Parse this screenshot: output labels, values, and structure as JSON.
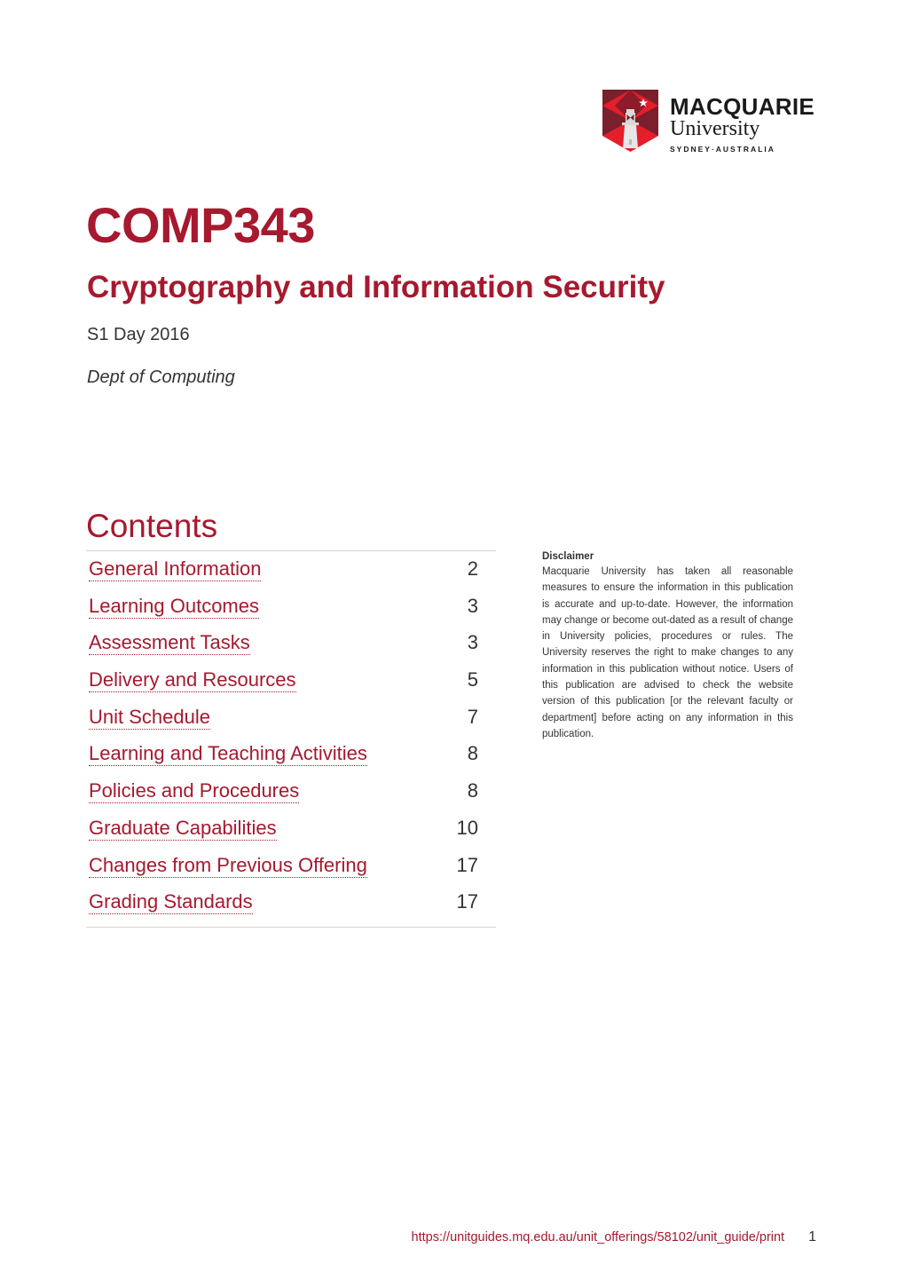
{
  "logo": {
    "name": "MACQUARIE",
    "sub": "University",
    "location": "SYDNEY·AUSTRALIA",
    "colors": {
      "red": "#e41e2b",
      "dark_red": "#7a1f2b",
      "tower": "#d9d9d9"
    }
  },
  "header": {
    "course_code": "COMP343",
    "course_title": "Cryptography and Information Security",
    "offering": "S1 Day 2016",
    "department": "Dept of Computing"
  },
  "contents": {
    "title": "Contents",
    "items": [
      {
        "label": "General Information",
        "page": "2"
      },
      {
        "label": "Learning Outcomes",
        "page": "3"
      },
      {
        "label": "Assessment Tasks",
        "page": "3"
      },
      {
        "label": "Delivery and Resources",
        "page": "5"
      },
      {
        "label": "Unit Schedule",
        "page": "7"
      },
      {
        "label": "Learning and Teaching Activities",
        "page": "8"
      },
      {
        "label": "Policies and Procedures",
        "page": "8"
      },
      {
        "label": "Graduate Capabilities",
        "page": "10"
      },
      {
        "label": "Changes from Previous Offering",
        "page": "17"
      },
      {
        "label": "Grading Standards",
        "page": "17"
      }
    ]
  },
  "disclaimer": {
    "title": "Disclaimer",
    "text": "Macquarie University has taken all reasonable measures to ensure the information in this publication is accurate and up-to-date. However, the information may change or become out-dated as a result of change in University policies, procedures or rules. The University reserves the right to make changes to any information in this publication without notice. Users of this publication are advised to check the website version of this publication [or the relevant faculty or department] before acting on any information in this publication."
  },
  "footer": {
    "url": "https://unitguides.mq.edu.au/unit_offerings/58102/unit_guide/print",
    "page_number": "1"
  },
  "theme": {
    "accent": "#a6192e",
    "text": "#333333",
    "rule": "#d8d4c6"
  }
}
